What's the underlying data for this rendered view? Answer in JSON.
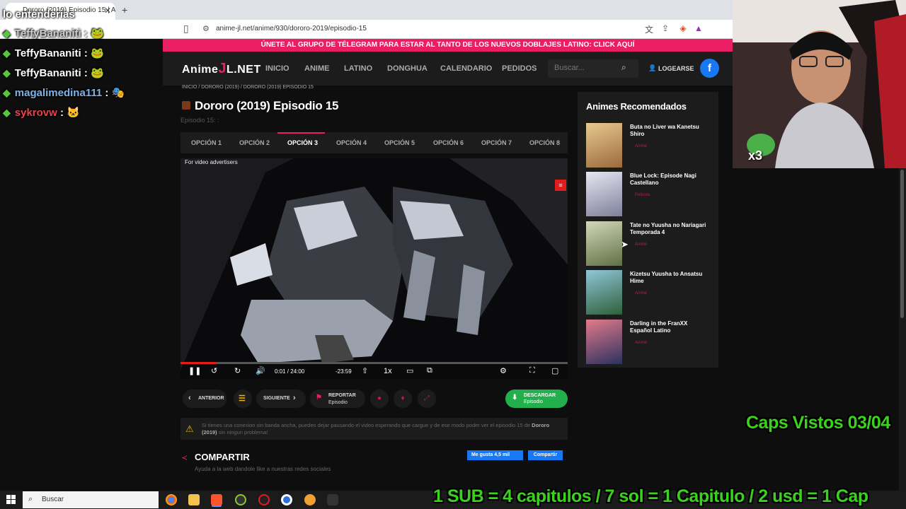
{
  "browser": {
    "tab_title": "Dororo (2019) Episodio 15 | A",
    "url": "anime-jl.net/anime/930/dororo-2019/episodio-15"
  },
  "chat": {
    "top_text": "lo entenderias",
    "messages": [
      {
        "user": "TeffyBananiti",
        "suffix": " :"
      },
      {
        "user": "TeffyBananiti",
        "suffix": " :"
      },
      {
        "user": "TeffyBananiti",
        "suffix": " :"
      },
      {
        "user": "magalimedina111",
        "suffix": " :"
      },
      {
        "user": "sykrovw",
        "suffix": " :"
      }
    ]
  },
  "banner": "ÚNETE AL GRUPO DE TÉLEGRAM PARA ESTAR AL TANTO DE LOS NUEVOS DOBLAJES LATINO: CLICK AQUÍ",
  "site": {
    "logo_left": "Anime",
    "logo_x": "J",
    "logo_right": "L.NET",
    "nav": [
      "INICIO",
      "ANIME",
      "LATINO",
      "DONGHUA",
      "CALENDARIO",
      "PEDIDOS"
    ],
    "search_placeholder": "Buscar...",
    "login": "LOGEARSE",
    "fb": "f"
  },
  "page": {
    "breadcrumb": "INICIO  /  DORORO (2019)  /  DORORO (2019) EPISODIO 15",
    "title": "Dororo (2019) Episodio 15",
    "subtitle": "Episodio 15: :",
    "options": [
      "OPCIÓN 1",
      "OPCIÓN 2",
      "OPCIÓN 3",
      "OPCIÓN 4",
      "OPCIÓN 5",
      "OPCIÓN 6",
      "OPCIÓN 7",
      "OPCIÓN 8"
    ],
    "active_option": 2
  },
  "player": {
    "label": "For video advertisers",
    "time_current": "0:01 / 24:00",
    "time_remaining": "-23:59",
    "speed": "1x",
    "progress": 0.0007
  },
  "nav_buttons": {
    "prev": "ANTERIOR",
    "next": "SIGUIENTE",
    "report_main": "REPORTAR",
    "report_sub": "Episodio",
    "download_main": "DESCARGAR",
    "download_sub": "Episodio"
  },
  "notice": {
    "text_a": "Si tienes una conexion sin banda ancha, puedes dejar pausando el video esperando que cargue y de ese modo poder ver el episodio 15 de ",
    "text_bold": "Dororo (2019)",
    "text_b": " sin ningun problema!"
  },
  "share": {
    "title": "COMPARTIR",
    "subtitle": "Ayuda a la web dandole like a nuestras redes sociales",
    "like": "Me gusta 4,5 mil",
    "share_btn": "Compartir"
  },
  "sidebar": {
    "title": "Animes Recomendados",
    "items": [
      {
        "title": "Buta no Liver wa Kanetsu Shiro",
        "tag": "Anime",
        "color": "#c7a36b"
      },
      {
        "title": "Blue Lock: Episode Nagi Castellano",
        "tag": "Pelicula",
        "color": "#c8c8d8"
      },
      {
        "title": "Tate no Yuusha no Nariagari Temporada 4",
        "tag": "Anime",
        "color": "#8fa26a"
      },
      {
        "title": "Kizetsu Yuusha to Ansatsu Hime",
        "tag": "Anime",
        "color": "#4b7fa0"
      },
      {
        "title": "Darling in the FranXX Español Latino",
        "tag": "Anime",
        "color": "#b0283a"
      }
    ]
  },
  "overlay": {
    "caps": "Caps Vistos 03/04",
    "subs": "1 SUB = 4 capitulos / 7 sol = 1 Capitulo / 2 usd = 1 Cap",
    "webcam_badge": "x3"
  },
  "taskbar": {
    "search": "Buscar"
  }
}
